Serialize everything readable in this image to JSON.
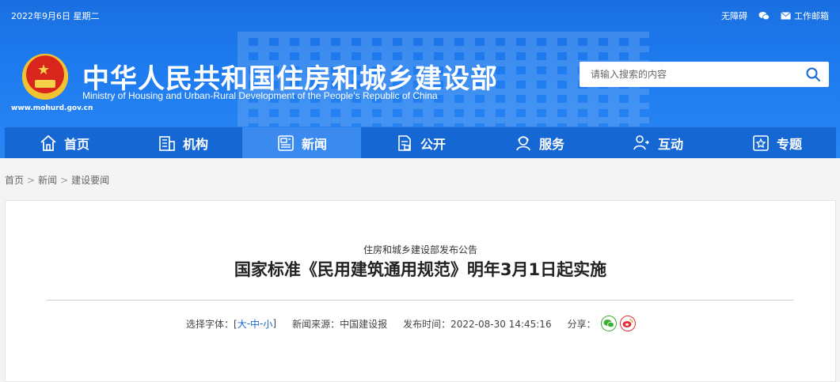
{
  "header": {
    "date": "2022年9月6日 星期二",
    "accessibility": "无障碍",
    "mail": "工作邮箱",
    "site_title": "中华人民共和国住房和城乡建设部",
    "site_title_en": "Ministry of Housing and Urban-Rural Development of the People’s Republic of China",
    "site_url": "www.mohurd.gov.cn",
    "search_placeholder": "请输入搜索的内容"
  },
  "nav": {
    "items": [
      {
        "label": "首页",
        "icon": "home-icon"
      },
      {
        "label": "机构",
        "icon": "building-icon"
      },
      {
        "label": "新闻",
        "icon": "news-icon",
        "active": true
      },
      {
        "label": "公开",
        "icon": "document-icon"
      },
      {
        "label": "服务",
        "icon": "service-icon"
      },
      {
        "label": "互动",
        "icon": "interaction-icon"
      },
      {
        "label": "专题",
        "icon": "topic-icon"
      }
    ]
  },
  "breadcrumb": [
    "首页",
    "新闻",
    "建设要闻"
  ],
  "breadcrumb_sep": ">",
  "article": {
    "subtitle": "住房和城乡建设部发布公告",
    "title": "国家标准《民用建筑通用规范》明年3月1日起实施",
    "font_label": "选择字体：[",
    "font_large": "大",
    "font_medium": "中",
    "font_small": "小",
    "font_dash": " - ",
    "font_close": "]",
    "source": "新闻来源：中国建设报",
    "time": "发布时间：2022-08-30 14:45:16",
    "share": "分享："
  },
  "colors": {
    "header_blue": "#1e7cf0",
    "nav_blue": "#1567d3",
    "nav_active": "#3a8af0",
    "wechat_green": "#3cb034",
    "weibo_red": "#e0313a"
  }
}
